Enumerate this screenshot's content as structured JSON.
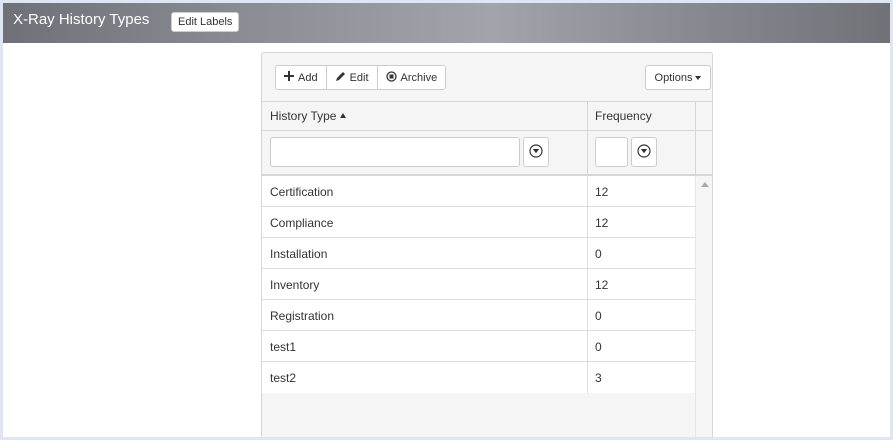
{
  "header": {
    "title": "X-Ray History Types",
    "edit_labels": "Edit Labels"
  },
  "toolbar": {
    "add_label": "Add",
    "edit_label": "Edit",
    "archive_label": "Archive",
    "options_label": "Options"
  },
  "grid": {
    "columns": [
      {
        "label": "History Type",
        "sorted": "ascending"
      },
      {
        "label": "Frequency"
      }
    ],
    "filters": {
      "history_type_value": "",
      "frequency_value": ""
    },
    "rows": [
      {
        "type": "Certification",
        "frequency": "12"
      },
      {
        "type": "Compliance",
        "frequency": "12"
      },
      {
        "type": "Installation",
        "frequency": "0"
      },
      {
        "type": "Inventory",
        "frequency": "12"
      },
      {
        "type": "Registration",
        "frequency": "0"
      },
      {
        "type": "test1",
        "frequency": "0"
      },
      {
        "type": "test2",
        "frequency": "3"
      }
    ]
  },
  "icons": {
    "add": "plus-icon",
    "edit": "pencil-icon",
    "archive": "archive-circle-icon",
    "filter": "filter-icon",
    "sort": "sort-ascending-icon",
    "options": "caret-down-icon"
  },
  "colors": {
    "header_gradient_mid": "#a2a4ab",
    "panel_bg": "#f5f5f5",
    "border": "#d6d6d6"
  }
}
